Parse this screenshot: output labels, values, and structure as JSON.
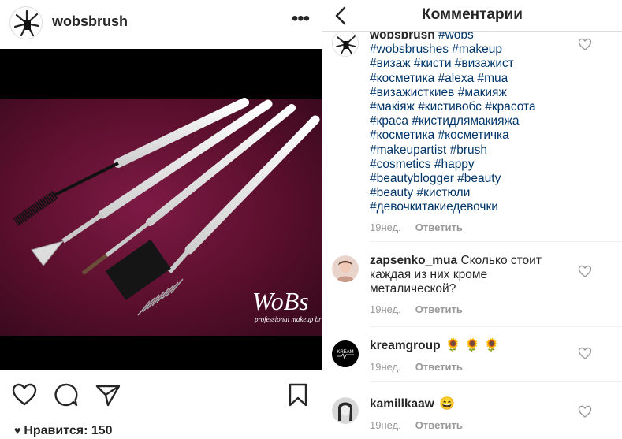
{
  "post": {
    "username": "wobsbrush",
    "more_icon": "more-dots-icon",
    "watermark": "WoBs",
    "watermark_sub": "professional makeup brush",
    "likes_label": "Нравится: 150",
    "actions": [
      "heart-icon",
      "comment-icon",
      "share-icon",
      "bookmark-icon"
    ]
  },
  "comments_view": {
    "title": "Комментарии",
    "back_icon": "chevron-left-icon",
    "comments": [
      {
        "user": "wobsbrush",
        "text_lines": [
          "#wobs",
          "#wobsbrushes #makeup",
          "#визаж #кисти #визажист",
          "#косметика #alexa #mua",
          "#визажисткиев #макияж",
          "#макіяж #кистивобс #красота",
          "#краса #кистидлямакияжа",
          "#косметика #косметичка",
          "#makeupartist #brush",
          "#cosmetics #happy",
          "#beautyblogger #beauty",
          "#beauty #кистюли",
          "#девочкитакиедевочки"
        ],
        "time": "19нед.",
        "reply": "Ответить"
      },
      {
        "user": "zapsenko_mua",
        "text_lines": [
          "Сколько стоит",
          "каждая из них кроме",
          "металической?"
        ],
        "time": "19нед.",
        "reply": "Ответить"
      },
      {
        "user": "kreamgroup",
        "emoji": "🌻 🌻 🌻",
        "time": "19нед.",
        "reply": "Ответить"
      },
      {
        "user": "kamillkaaw",
        "emoji": "😄",
        "time": "19нед.",
        "reply": "Ответить"
      }
    ]
  },
  "colors": {
    "hashtag": "#003569",
    "meta": "#999999",
    "text": "#262626",
    "photo_background": "#5a0f2c"
  }
}
